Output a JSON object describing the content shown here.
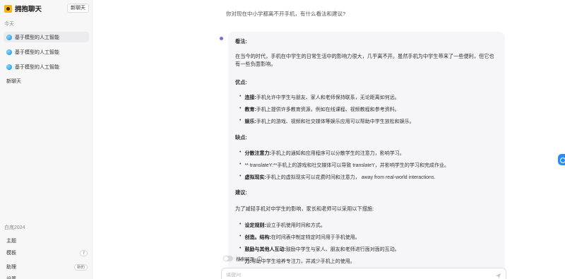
{
  "sidebar": {
    "brand": "拥抱聊天",
    "new_chat_button": "新聊天",
    "today_label": "今天",
    "history": [
      {
        "label": "基于模型的人工智能"
      },
      {
        "label": "基于模型的人工智能"
      },
      {
        "label": "基于模型的人工智能"
      }
    ],
    "new_chat_link": "新聊天",
    "bottom": {
      "theme": "白底2024",
      "home": "主题",
      "models": "模板",
      "models_count": "7",
      "assistants": "助理",
      "assistants_badge": "新的",
      "settings": "设置"
    }
  },
  "chat": {
    "user_question": "你对现在中小学都离不开手机，有什么看法和建议?",
    "answer": {
      "heading_view": "看法:",
      "intro": "在当今的时代，手机在中学生的日常生活中的影响力很大，几乎离不开。虽然手机为中学生带来了一些便利，但它也有一些负面影响。",
      "heading_pros": "优点:",
      "pros": [
        {
          "title": "连接:",
          "text": "手机允许中学生与朋友、家人和老师保持联系，无论距离如何远。"
        },
        {
          "title": "教育:",
          "text": "手机上提供许多教育资源，例如在线课程、视频教程和参考资料。"
        },
        {
          "title": "娱乐:",
          "text": "手机上的游戏、视频和社交媒体等娱乐应用可以帮助中学生放松和娱乐。"
        }
      ],
      "heading_cons": "缺点:",
      "cons": [
        {
          "title": "分散注意力:",
          "text": "手机上的通知和应用程序可以分散学生的注意力，影响学习。"
        },
        {
          "title": "** translateY:",
          "text": "**手机上的游戏和社交媒体可以导致 translateY，并影响学生的学习和完成作业。"
        },
        {
          "title": "虚拟现实:",
          "text": "手机上的虚拟现实可以花费时间和注意力， away from real-world interactions."
        }
      ],
      "heading_advice": "建议:",
      "advice_intro": "为了减轻手机对中学生的影响，家长和老师可以采用以下措施:",
      "advice": [
        {
          "title": "设定规则:",
          "text": "设立手机使用时间和方式。"
        },
        {
          "title": "创造。结构:",
          "text": "在时间表中制定特定时间用于手机使用。"
        },
        {
          "title": "鼓励与其他人互动:",
          "text": "鼓励中学生与家人、朋友和老师进行面对面的互动。"
        },
        {
          "title": "力:",
          "text": "帮助中学生培养专注力，并减少手机上的使用。"
        }
      ]
    }
  },
  "composer": {
    "web_search_label": "搜索网页",
    "placeholder": "请提问"
  },
  "colors": {
    "accent": "#2b8cf5",
    "brand": "#f5b700",
    "bot_indicator": "#7c6ce0"
  }
}
